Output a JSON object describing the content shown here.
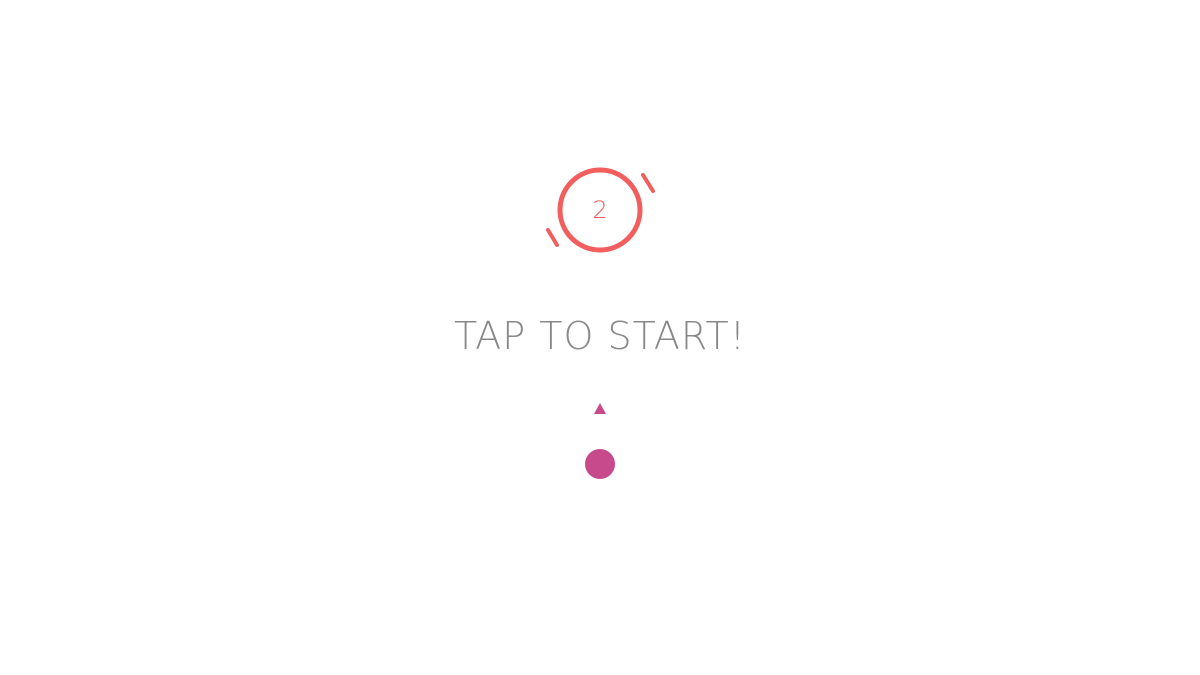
{
  "game": {
    "level": "2",
    "prompt": "TAP TO START!"
  },
  "colors": {
    "background": "#ffffff",
    "target": "#f25e5e",
    "player": "#c74b8c",
    "prompt": "#888888"
  },
  "icons": {
    "target": "ring-target-icon",
    "aim": "triangle-pointer-icon",
    "player": "ball-icon"
  }
}
